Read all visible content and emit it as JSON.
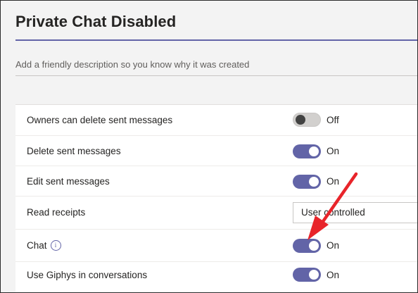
{
  "page": {
    "title": "Private Chat Disabled",
    "description_placeholder": "Add a friendly description so you know why it was created"
  },
  "settings": {
    "rows": [
      {
        "label": "Owners can delete sent messages",
        "control": "toggle",
        "state": "off",
        "state_label": "Off"
      },
      {
        "label": "Delete sent messages",
        "control": "toggle",
        "state": "on",
        "state_label": "On"
      },
      {
        "label": "Edit sent messages",
        "control": "toggle",
        "state": "on",
        "state_label": "On"
      },
      {
        "label": "Read receipts",
        "control": "select",
        "selected": "User controlled"
      },
      {
        "label": "Chat",
        "control": "toggle",
        "state": "on",
        "state_label": "On",
        "icon": "info-icon"
      },
      {
        "label": "Use Giphys in conversations",
        "control": "toggle",
        "state": "on",
        "state_label": "On"
      }
    ]
  },
  "colors": {
    "accent": "#6264a7",
    "annotation_arrow": "#e8242a"
  }
}
